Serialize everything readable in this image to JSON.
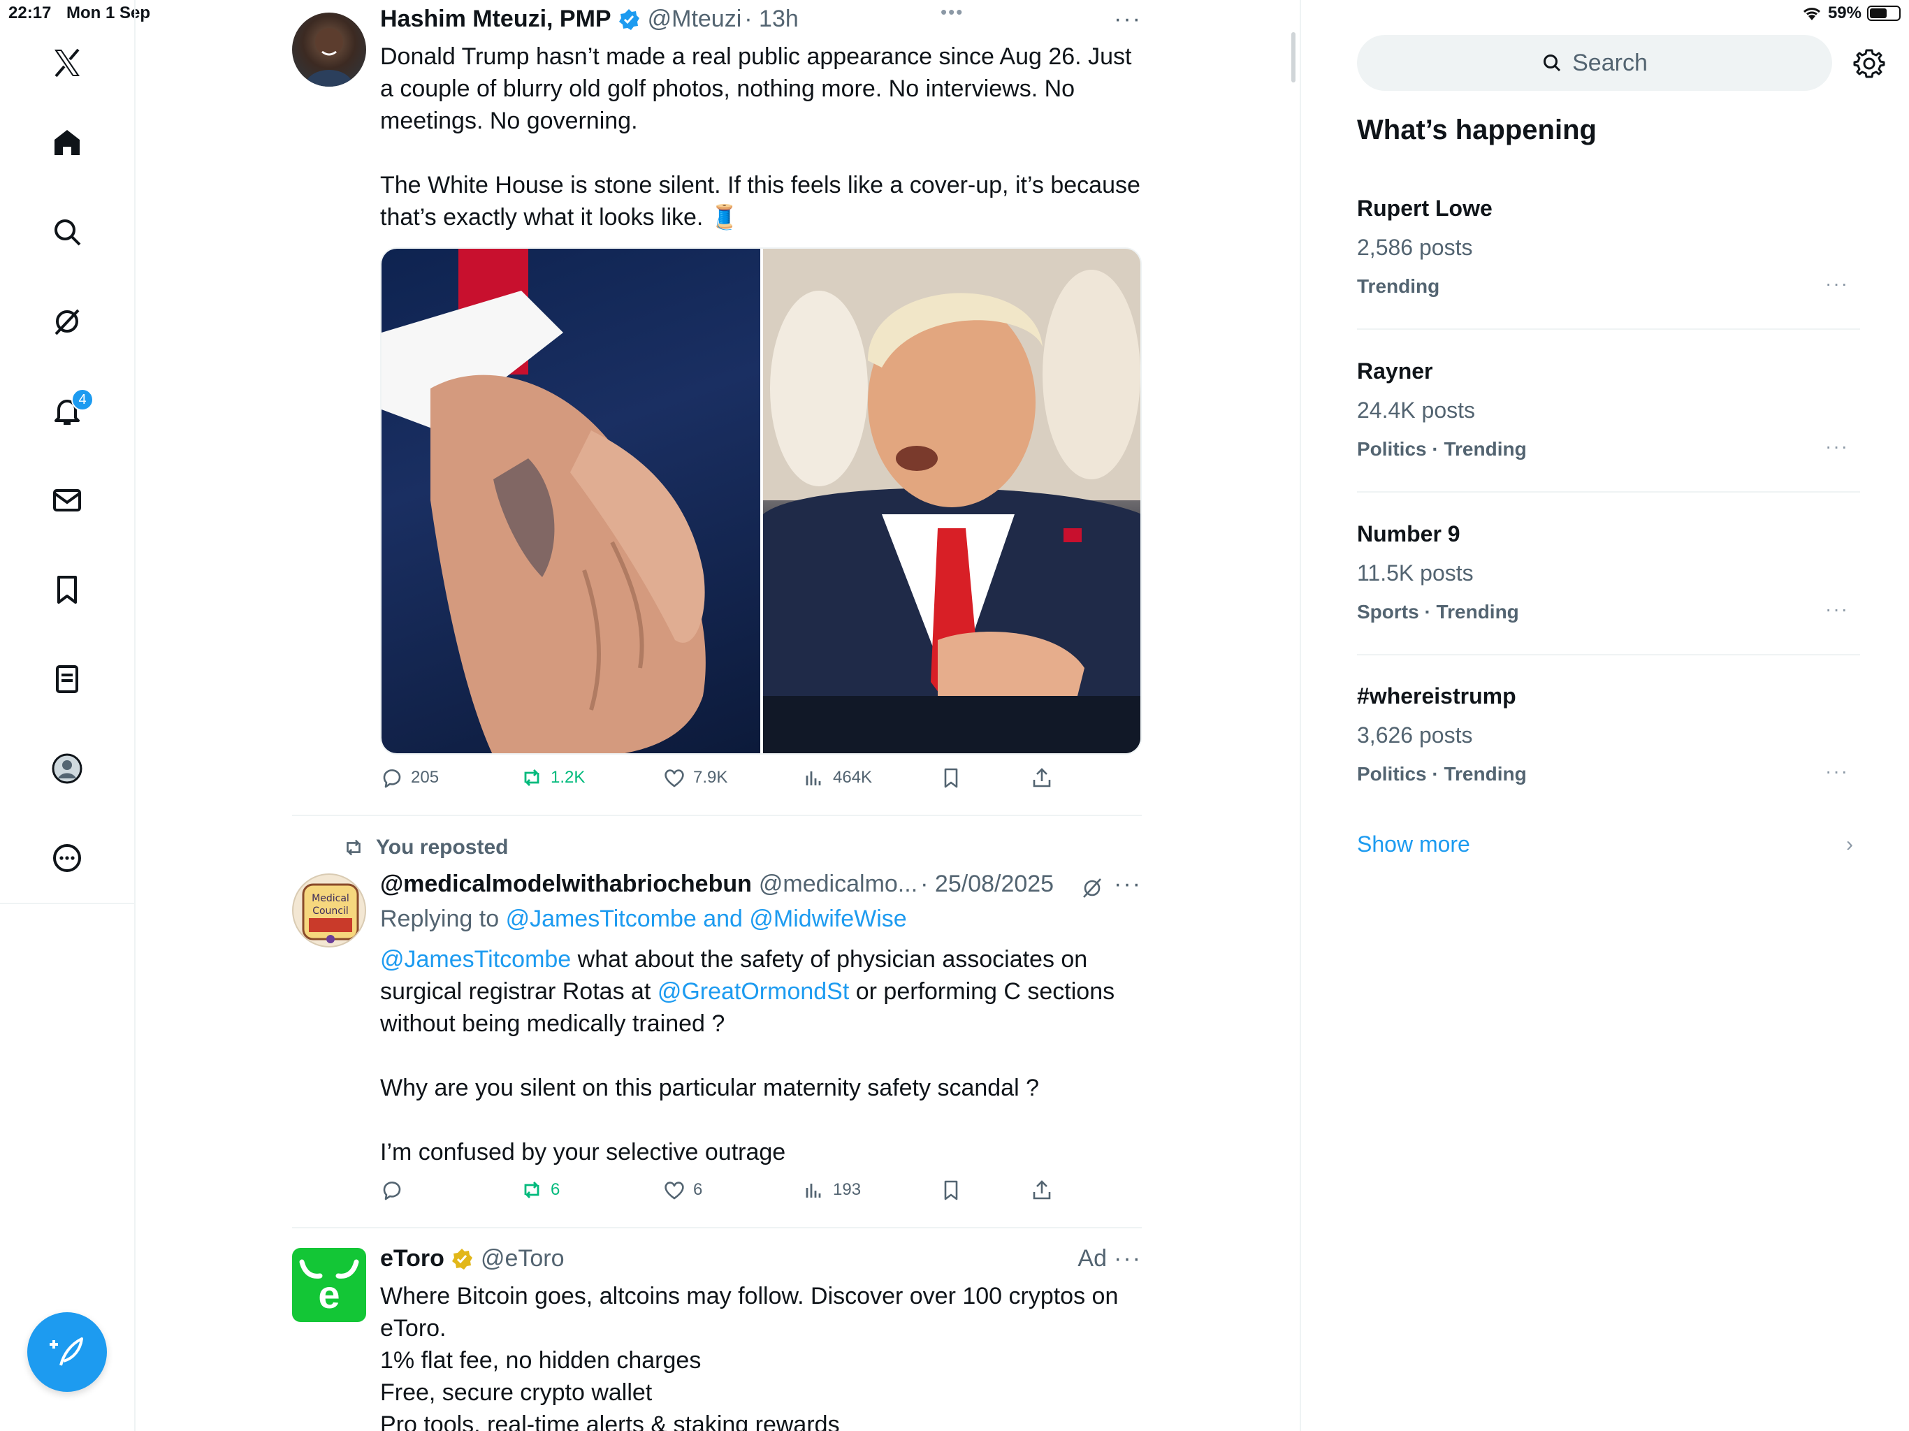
{
  "status_bar": {
    "time": "22:17",
    "date": "Mon 1 Sep",
    "battery_text": "59%",
    "battery_level": 0.59
  },
  "nav": {
    "notifications_badge": "4",
    "icons": [
      "x-logo-icon",
      "home-icon",
      "search-icon",
      "grok-icon",
      "notifications-icon",
      "messages-icon",
      "bookmarks-icon",
      "lists-icon",
      "profile-icon",
      "more-icon"
    ]
  },
  "tweets": [
    {
      "name": "Hashim Mteuzi, PMP",
      "handle": "@Mteuzi",
      "time": "· 13h",
      "top_dots": "•••",
      "text": [
        "Donald Trump hasn’t made a real public appearance since Aug 26. Just a couple of blurry old golf photos, nothing more. No interviews. No meetings. No governing.",
        "The White House is stone silent. If this feels like a cover-up, it’s because that’s exactly what it looks like. 🧵"
      ],
      "stats": {
        "replies": "205",
        "reposts": "1.2K",
        "likes": "7.9K",
        "views": "464K"
      }
    },
    {
      "reposted_label": "You reposted",
      "name": "@medicalmodelwithabriochebun",
      "handle": "@medicalmo...",
      "time": "· 25/08/2025",
      "replying_prefix": "Replying to",
      "replying_to": "@JamesTitcombe and @MidwifeWise",
      "mention1": "@JamesTitcombe",
      "text1a": " what about the safety of physician associates on surgical registrar Rotas at ",
      "mention2": "@GreatOrmondSt",
      "text1b": " or performing C sections without being medically trained ?",
      "text2": "Why are you silent on this particular maternity safety scandal ?",
      "text3": "I’m confused by your selective outrage",
      "stats": {
        "replies": "",
        "reposts": "6",
        "likes": "6",
        "views": "193"
      }
    },
    {
      "name": "eToro",
      "handle": "@eToro",
      "ad_label": "Ad",
      "text": [
        "Where Bitcoin goes, altcoins may follow. Discover over 100 cryptos on eToro.",
        "1% flat fee, no hidden charges",
        "Free, secure crypto wallet",
        "Pro tools, real-time alerts & staking rewards"
      ]
    }
  ],
  "sidebar": {
    "search_placeholder": "Search",
    "title": "What’s happening",
    "trends": [
      {
        "name": "Rupert Lowe",
        "posts": "2,586 posts",
        "category": "Trending"
      },
      {
        "name": "Rayner",
        "posts": "24.4K posts",
        "category": "Politics · Trending"
      },
      {
        "name": "Number 9",
        "posts": "11.5K posts",
        "category": "Sports · Trending"
      },
      {
        "name": "#whereistrump",
        "posts": "3,626 posts",
        "category": "Politics · Trending"
      }
    ],
    "show_more": "Show more"
  },
  "colors": {
    "accent": "#1d9bf0",
    "repost_green": "#00ba7c",
    "muted": "#536471",
    "etoro_green": "#13c636",
    "verified_gold": "#e2b719"
  }
}
